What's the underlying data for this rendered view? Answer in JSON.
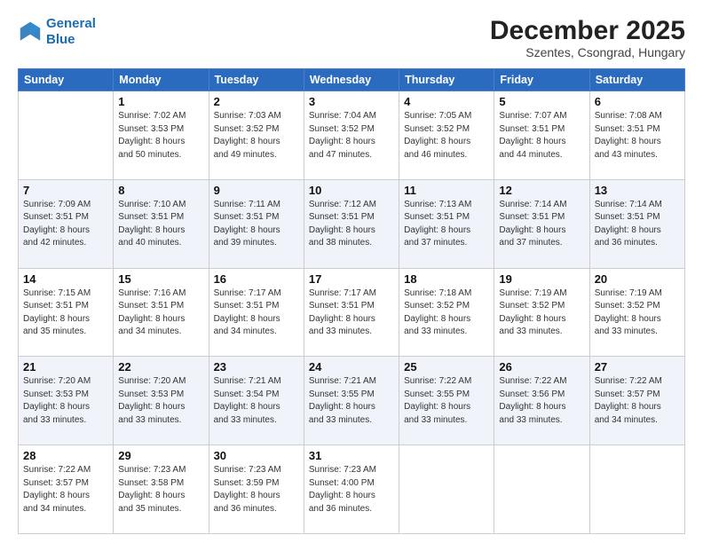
{
  "logo": {
    "line1": "General",
    "line2": "Blue"
  },
  "title": "December 2025",
  "subtitle": "Szentes, Csongrad, Hungary",
  "weekdays": [
    "Sunday",
    "Monday",
    "Tuesday",
    "Wednesday",
    "Thursday",
    "Friday",
    "Saturday"
  ],
  "weeks": [
    [
      {
        "day": "",
        "info": ""
      },
      {
        "day": "1",
        "info": "Sunrise: 7:02 AM\nSunset: 3:53 PM\nDaylight: 8 hours\nand 50 minutes."
      },
      {
        "day": "2",
        "info": "Sunrise: 7:03 AM\nSunset: 3:52 PM\nDaylight: 8 hours\nand 49 minutes."
      },
      {
        "day": "3",
        "info": "Sunrise: 7:04 AM\nSunset: 3:52 PM\nDaylight: 8 hours\nand 47 minutes."
      },
      {
        "day": "4",
        "info": "Sunrise: 7:05 AM\nSunset: 3:52 PM\nDaylight: 8 hours\nand 46 minutes."
      },
      {
        "day": "5",
        "info": "Sunrise: 7:07 AM\nSunset: 3:51 PM\nDaylight: 8 hours\nand 44 minutes."
      },
      {
        "day": "6",
        "info": "Sunrise: 7:08 AM\nSunset: 3:51 PM\nDaylight: 8 hours\nand 43 minutes."
      }
    ],
    [
      {
        "day": "7",
        "info": "Sunrise: 7:09 AM\nSunset: 3:51 PM\nDaylight: 8 hours\nand 42 minutes."
      },
      {
        "day": "8",
        "info": "Sunrise: 7:10 AM\nSunset: 3:51 PM\nDaylight: 8 hours\nand 40 minutes."
      },
      {
        "day": "9",
        "info": "Sunrise: 7:11 AM\nSunset: 3:51 PM\nDaylight: 8 hours\nand 39 minutes."
      },
      {
        "day": "10",
        "info": "Sunrise: 7:12 AM\nSunset: 3:51 PM\nDaylight: 8 hours\nand 38 minutes."
      },
      {
        "day": "11",
        "info": "Sunrise: 7:13 AM\nSunset: 3:51 PM\nDaylight: 8 hours\nand 37 minutes."
      },
      {
        "day": "12",
        "info": "Sunrise: 7:14 AM\nSunset: 3:51 PM\nDaylight: 8 hours\nand 37 minutes."
      },
      {
        "day": "13",
        "info": "Sunrise: 7:14 AM\nSunset: 3:51 PM\nDaylight: 8 hours\nand 36 minutes."
      }
    ],
    [
      {
        "day": "14",
        "info": "Sunrise: 7:15 AM\nSunset: 3:51 PM\nDaylight: 8 hours\nand 35 minutes."
      },
      {
        "day": "15",
        "info": "Sunrise: 7:16 AM\nSunset: 3:51 PM\nDaylight: 8 hours\nand 34 minutes."
      },
      {
        "day": "16",
        "info": "Sunrise: 7:17 AM\nSunset: 3:51 PM\nDaylight: 8 hours\nand 34 minutes."
      },
      {
        "day": "17",
        "info": "Sunrise: 7:17 AM\nSunset: 3:51 PM\nDaylight: 8 hours\nand 33 minutes."
      },
      {
        "day": "18",
        "info": "Sunrise: 7:18 AM\nSunset: 3:52 PM\nDaylight: 8 hours\nand 33 minutes."
      },
      {
        "day": "19",
        "info": "Sunrise: 7:19 AM\nSunset: 3:52 PM\nDaylight: 8 hours\nand 33 minutes."
      },
      {
        "day": "20",
        "info": "Sunrise: 7:19 AM\nSunset: 3:52 PM\nDaylight: 8 hours\nand 33 minutes."
      }
    ],
    [
      {
        "day": "21",
        "info": "Sunrise: 7:20 AM\nSunset: 3:53 PM\nDaylight: 8 hours\nand 33 minutes."
      },
      {
        "day": "22",
        "info": "Sunrise: 7:20 AM\nSunset: 3:53 PM\nDaylight: 8 hours\nand 33 minutes."
      },
      {
        "day": "23",
        "info": "Sunrise: 7:21 AM\nSunset: 3:54 PM\nDaylight: 8 hours\nand 33 minutes."
      },
      {
        "day": "24",
        "info": "Sunrise: 7:21 AM\nSunset: 3:55 PM\nDaylight: 8 hours\nand 33 minutes."
      },
      {
        "day": "25",
        "info": "Sunrise: 7:22 AM\nSunset: 3:55 PM\nDaylight: 8 hours\nand 33 minutes."
      },
      {
        "day": "26",
        "info": "Sunrise: 7:22 AM\nSunset: 3:56 PM\nDaylight: 8 hours\nand 33 minutes."
      },
      {
        "day": "27",
        "info": "Sunrise: 7:22 AM\nSunset: 3:57 PM\nDaylight: 8 hours\nand 34 minutes."
      }
    ],
    [
      {
        "day": "28",
        "info": "Sunrise: 7:22 AM\nSunset: 3:57 PM\nDaylight: 8 hours\nand 34 minutes."
      },
      {
        "day": "29",
        "info": "Sunrise: 7:23 AM\nSunset: 3:58 PM\nDaylight: 8 hours\nand 35 minutes."
      },
      {
        "day": "30",
        "info": "Sunrise: 7:23 AM\nSunset: 3:59 PM\nDaylight: 8 hours\nand 36 minutes."
      },
      {
        "day": "31",
        "info": "Sunrise: 7:23 AM\nSunset: 4:00 PM\nDaylight: 8 hours\nand 36 minutes."
      },
      {
        "day": "",
        "info": ""
      },
      {
        "day": "",
        "info": ""
      },
      {
        "day": "",
        "info": ""
      }
    ]
  ]
}
